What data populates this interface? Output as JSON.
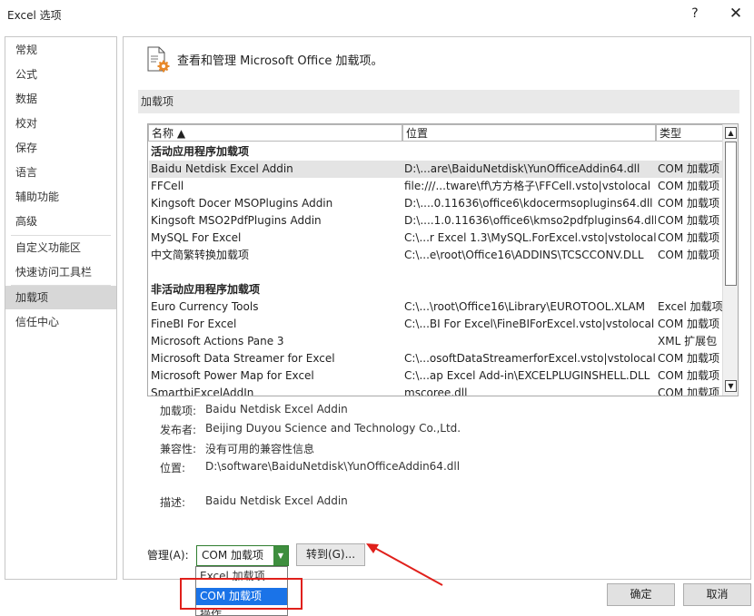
{
  "window": {
    "title": "Excel 选项",
    "help": "?",
    "close": "✕"
  },
  "nav": {
    "items": [
      {
        "label": "常规"
      },
      {
        "label": "公式"
      },
      {
        "label": "数据"
      },
      {
        "label": "校对"
      },
      {
        "label": "保存"
      },
      {
        "label": "语言"
      },
      {
        "label": "辅助功能"
      },
      {
        "label": "高级"
      },
      {
        "label": "自定义功能区"
      },
      {
        "label": "快速访问工具栏"
      },
      {
        "label": "加载项"
      },
      {
        "label": "信任中心"
      }
    ],
    "active": "加载项"
  },
  "main": {
    "header": "查看和管理 Microsoft Office 加载项。",
    "section_title": "加载项",
    "table": {
      "columns": [
        "名称 ▲",
        "位置",
        "类型"
      ],
      "active_group": "活动应用程序加载项",
      "active_rows": [
        {
          "name": "Baidu Netdisk Excel Addin",
          "location": "D:\\...are\\BaiduNetdisk\\YunOfficeAddin64.dll",
          "type": "COM 加载项"
        },
        {
          "name": "FFCell",
          "location": "file:///...tware\\ff\\方方格子\\FFCell.vsto|vstolocal",
          "type": "COM 加载项"
        },
        {
          "name": "Kingsoft Docer MSOPlugins Addin",
          "location": "D:\\....0.11636\\office6\\kdocermsoplugins64.dll",
          "type": "COM 加载项"
        },
        {
          "name": "Kingsoft MSO2PdfPlugins Addin",
          "location": "D:\\....1.0.11636\\office6\\kmso2pdfplugins64.dll",
          "type": "COM 加载项"
        },
        {
          "name": "MySQL For Excel",
          "location": "C:\\...r Excel 1.3\\MySQL.ForExcel.vsto|vstolocal",
          "type": "COM 加载项"
        },
        {
          "name": "中文简繁转换加载项",
          "location": "C:\\...e\\root\\Office16\\ADDINS\\TCSCCONV.DLL",
          "type": "COM 加载项"
        }
      ],
      "inactive_group": "非活动应用程序加载项",
      "inactive_rows": [
        {
          "name": "Euro Currency Tools",
          "location": "C:\\...\\root\\Office16\\Library\\EUROTOOL.XLAM",
          "type": "Excel 加载项"
        },
        {
          "name": "FineBI For Excel",
          "location": "C:\\...BI For Excel\\FineBIForExcel.vsto|vstolocal",
          "type": "COM 加载项"
        },
        {
          "name": "Microsoft Actions Pane 3",
          "location": "",
          "type": "XML 扩展包"
        },
        {
          "name": "Microsoft Data Streamer for Excel",
          "location": "C:\\...osoftDataStreamerforExcel.vsto|vstolocal",
          "type": "COM 加载项"
        },
        {
          "name": "Microsoft Power Map for Excel",
          "location": "C:\\...ap Excel Add-in\\EXCELPLUGINSHELL.DLL",
          "type": "COM 加载项"
        },
        {
          "name": "SmartbiExcelAddIn",
          "location": "mscoree.dll",
          "type": "COM 加载项"
        }
      ]
    },
    "details": {
      "addin_label": "加载项:",
      "addin_value": "Baidu Netdisk Excel Addin",
      "publisher_label": "发布者:",
      "publisher_value": "Beijing Duyou Science and Technology Co.,Ltd.",
      "compat_label": "兼容性:",
      "compat_value": "没有可用的兼容性信息",
      "location_label": "位置:",
      "location_value": "D:\\software\\BaiduNetdisk\\YunOfficeAddin64.dll",
      "desc_label": "描述:",
      "desc_value": "Baidu Netdisk Excel Addin"
    },
    "manage": {
      "label": "管理(A):",
      "selected": "COM 加载项",
      "goto": "转到(G)...",
      "options": [
        "Excel 加载项",
        "COM 加载项",
        "操作"
      ]
    }
  },
  "buttons": {
    "ok": "确定",
    "cancel": "取消"
  },
  "colors": {
    "annotation": "#e0201b",
    "selection": "#1a73e8",
    "combo_accent": "#3e8e3e"
  }
}
